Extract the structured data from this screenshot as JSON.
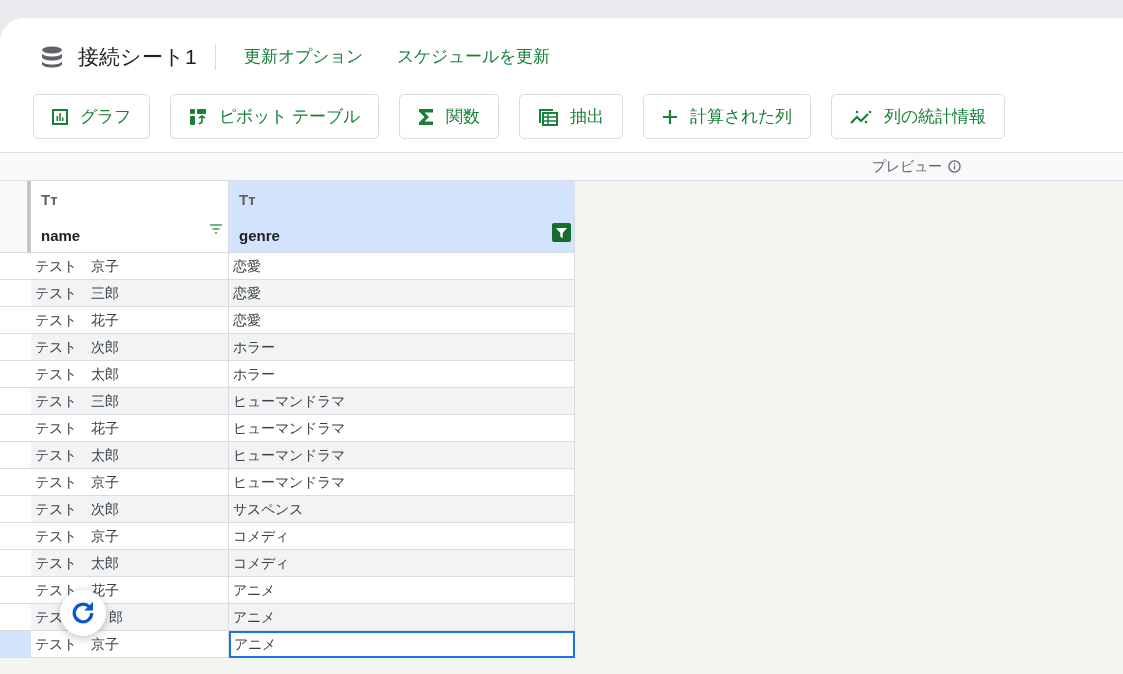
{
  "header": {
    "title": "接続シート1",
    "links": [
      "更新オプション",
      "スケジュールを更新"
    ]
  },
  "toolbar": [
    {
      "kind": "chart",
      "label": "グラフ"
    },
    {
      "kind": "pivot",
      "label": "ピボット テーブル"
    },
    {
      "kind": "function",
      "label": "関数"
    },
    {
      "kind": "extract",
      "label": "抽出"
    },
    {
      "kind": "calculated",
      "label": "計算された列"
    },
    {
      "kind": "stats",
      "label": "列の統計情報"
    }
  ],
  "preview": {
    "label": "プレビュー"
  },
  "table": {
    "columns": [
      {
        "type_icon": "Tт",
        "name": "name",
        "selected": false,
        "filtered": false
      },
      {
        "type_icon": "Tт",
        "name": "genre",
        "selected": true,
        "filtered": true
      }
    ],
    "rows": [
      {
        "cells": [
          "テスト　京子",
          "恋愛"
        ],
        "selected": false
      },
      {
        "cells": [
          "テスト　三郎",
          "恋愛"
        ],
        "selected": false
      },
      {
        "cells": [
          "テスト　花子",
          "恋愛"
        ],
        "selected": false
      },
      {
        "cells": [
          "テスト　次郎",
          "ホラー"
        ],
        "selected": false
      },
      {
        "cells": [
          "テスト　太郎",
          "ホラー"
        ],
        "selected": false
      },
      {
        "cells": [
          "テスト　三郎",
          "ヒューマンドラマ"
        ],
        "selected": false
      },
      {
        "cells": [
          "テスト　花子",
          "ヒューマンドラマ"
        ],
        "selected": false
      },
      {
        "cells": [
          "テスト　太郎",
          "ヒューマンドラマ"
        ],
        "selected": false
      },
      {
        "cells": [
          "テスト　京子",
          "ヒューマンドラマ"
        ],
        "selected": false
      },
      {
        "cells": [
          "テスト　次郎",
          "サスペンス"
        ],
        "selected": false
      },
      {
        "cells": [
          "テスト　京子",
          "コメディ"
        ],
        "selected": false
      },
      {
        "cells": [
          "テスト　太郎",
          "コメディ"
        ],
        "selected": false
      },
      {
        "cells": [
          "テスト　花子",
          "アニメ"
        ],
        "selected": false
      },
      {
        "cells": [
          {
            "parts": [
              "テス",
              "郎"
            ]
          },
          "アニメ"
        ],
        "selected": false
      },
      {
        "cells": [
          "テスト　京子",
          "アニメ"
        ],
        "selected": true
      }
    ]
  }
}
